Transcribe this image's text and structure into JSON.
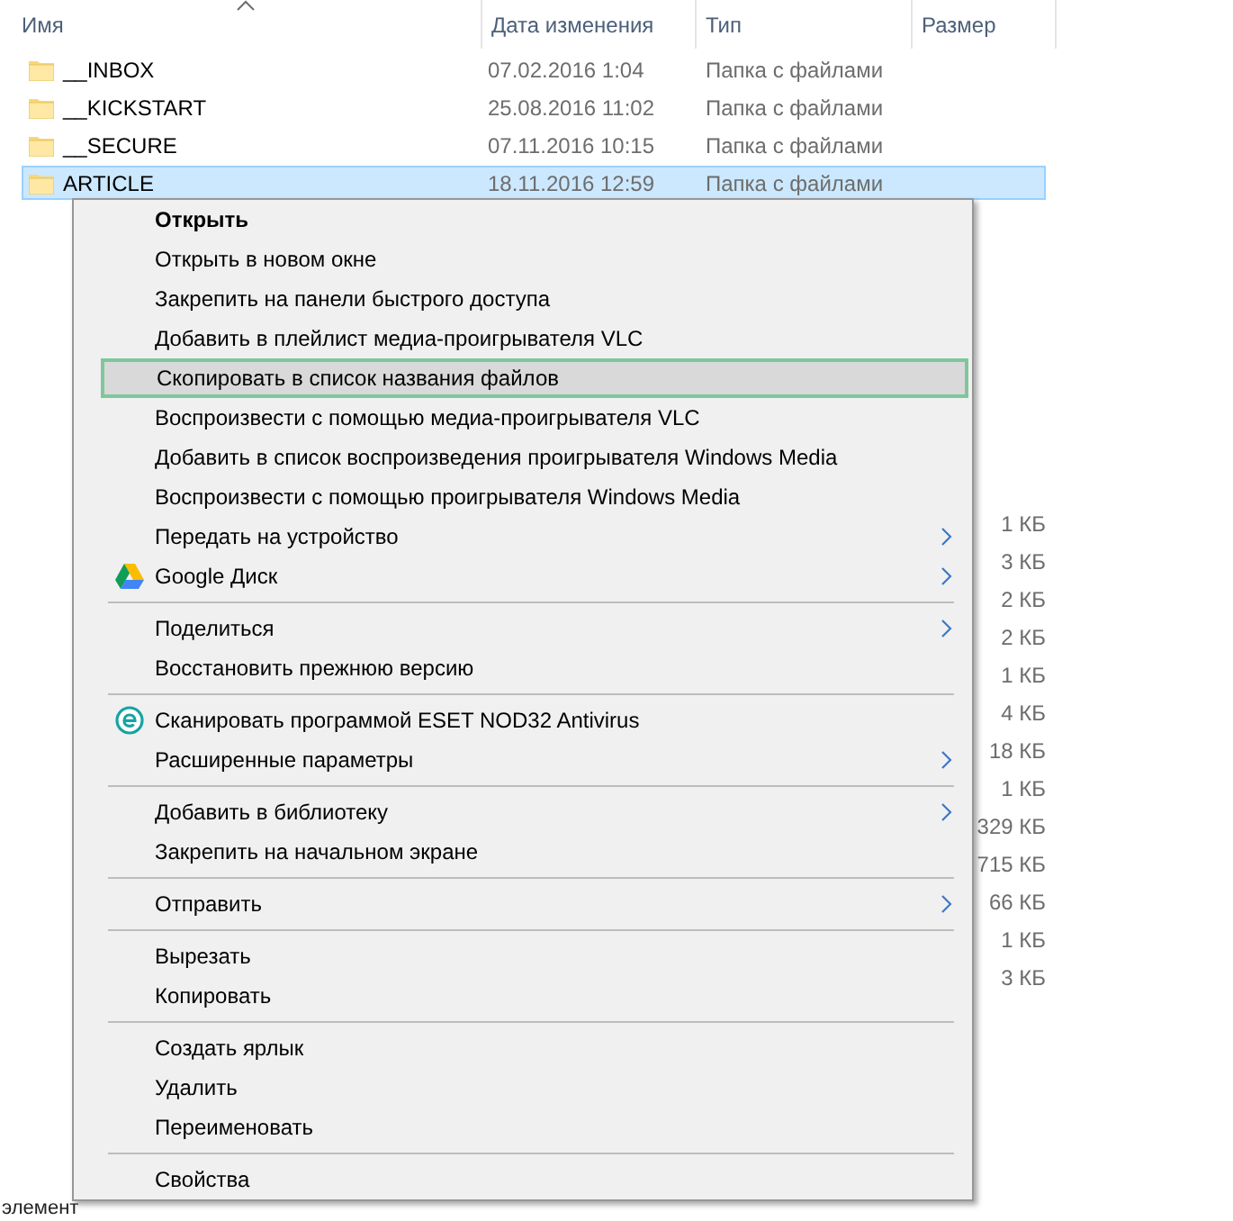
{
  "header": {
    "columns": [
      {
        "label": "Имя",
        "sorted": true
      },
      {
        "label": "Дата изменения",
        "sorted": false
      },
      {
        "label": "Тип",
        "sorted": false
      },
      {
        "label": "Размер",
        "sorted": false
      }
    ]
  },
  "rows": [
    {
      "name": "__INBOX",
      "date": "07.02.2016 1:04",
      "type": "Папка с файлами",
      "selected": false
    },
    {
      "name": "__KICKSTART",
      "date": "25.08.2016 11:02",
      "type": "Папка с файлами",
      "selected": false
    },
    {
      "name": "__SECURE",
      "date": "07.11.2016 10:15",
      "type": "Папка с файлами",
      "selected": false
    },
    {
      "name": "ARTICLE",
      "date": "18.11.2016 12:59",
      "type": "Папка с файлами",
      "selected": true
    }
  ],
  "sizes": [
    "1 КБ",
    "3 КБ",
    "2 КБ",
    "2 КБ",
    "1 КБ",
    "4 КБ",
    "18 КБ",
    "1 КБ",
    "329 КБ",
    "715 КБ",
    "66 КБ",
    "1 КБ",
    "3 КБ"
  ],
  "context_menu": {
    "items": [
      {
        "kind": "item",
        "label": "Открыть",
        "default": true,
        "selected": false,
        "submenu": false
      },
      {
        "kind": "item",
        "label": "Открыть в новом окне",
        "default": false,
        "selected": false,
        "submenu": false
      },
      {
        "kind": "item",
        "label": "Закрепить на панели быстрого доступа",
        "default": false,
        "selected": false,
        "submenu": false
      },
      {
        "kind": "item",
        "label": "Добавить в плейлист медиа-проигрывателя VLC",
        "default": false,
        "selected": false,
        "submenu": false
      },
      {
        "kind": "item",
        "label": "Скопировать в список названия файлов",
        "default": false,
        "selected": true,
        "submenu": false
      },
      {
        "kind": "item",
        "label": "Воспроизвести с помощью медиа-проигрывателя VLC",
        "default": false,
        "selected": false,
        "submenu": false
      },
      {
        "kind": "item",
        "label": "Добавить в список воспроизведения проигрывателя Windows Media",
        "default": false,
        "selected": false,
        "submenu": false
      },
      {
        "kind": "item",
        "label": "Воспроизвести с помощью проигрывателя Windows Media",
        "default": false,
        "selected": false,
        "submenu": false
      },
      {
        "kind": "item",
        "label": "Передать на устройство",
        "default": false,
        "selected": false,
        "submenu": true
      },
      {
        "kind": "drive-item",
        "label": "Google Диск",
        "default": false,
        "selected": false,
        "submenu": true
      },
      {
        "kind": "separator"
      },
      {
        "kind": "item",
        "label": "Поделиться",
        "default": false,
        "selected": false,
        "submenu": true
      },
      {
        "kind": "item",
        "label": "Восстановить прежнюю версию",
        "default": false,
        "selected": false,
        "submenu": false
      },
      {
        "kind": "separator"
      },
      {
        "kind": "eset-item",
        "label": "Сканировать программой ESET NOD32 Antivirus",
        "default": false,
        "selected": false,
        "submenu": false
      },
      {
        "kind": "item",
        "label": "Расширенные параметры",
        "default": false,
        "selected": false,
        "submenu": true
      },
      {
        "kind": "separator"
      },
      {
        "kind": "item",
        "label": "Добавить в библиотеку",
        "default": false,
        "selected": false,
        "submenu": true
      },
      {
        "kind": "item",
        "label": "Закрепить на начальном экране",
        "default": false,
        "selected": false,
        "submenu": false
      },
      {
        "kind": "separator"
      },
      {
        "kind": "item",
        "label": "Отправить",
        "default": false,
        "selected": false,
        "submenu": true
      },
      {
        "kind": "separator"
      },
      {
        "kind": "item",
        "label": "Вырезать",
        "default": false,
        "selected": false,
        "submenu": false
      },
      {
        "kind": "item",
        "label": "Копировать",
        "default": false,
        "selected": false,
        "submenu": false
      },
      {
        "kind": "separator"
      },
      {
        "kind": "item",
        "label": "Создать ярлык",
        "default": false,
        "selected": false,
        "submenu": false
      },
      {
        "kind": "item",
        "label": "Удалить",
        "default": false,
        "selected": false,
        "submenu": false
      },
      {
        "kind": "item",
        "label": "Переименовать",
        "default": false,
        "selected": false,
        "submenu": false
      },
      {
        "kind": "separator"
      },
      {
        "kind": "item",
        "label": "Свойства",
        "default": false,
        "selected": false,
        "submenu": false
      }
    ]
  },
  "status_bar": {
    "text": "элемент"
  }
}
